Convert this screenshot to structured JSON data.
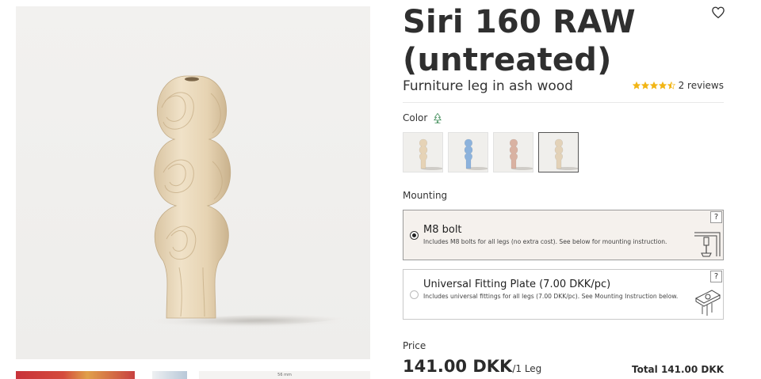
{
  "product": {
    "title_line1": "Siri 160 RAW",
    "title_line2": "(untreated)",
    "subtitle": "Furniture leg in ash wood",
    "rating": 4.5,
    "rating_max": 5,
    "reviews_label": "2 reviews",
    "star_color": "#f2b515"
  },
  "gallery": {
    "dimension_caption": "56 mm"
  },
  "color": {
    "label": "Color",
    "fsc_icon": "fsc-tree-icon",
    "swatches": [
      {
        "name": "raw-ash",
        "hex": "#e6d3b6",
        "selected": false
      },
      {
        "name": "blue",
        "hex": "#8cb2dc",
        "selected": false
      },
      {
        "name": "rose",
        "hex": "#d9b2a2",
        "selected": false
      },
      {
        "name": "raw-untreated",
        "hex": "#e3d2b8",
        "selected": true
      }
    ]
  },
  "mounting": {
    "label": "Mounting",
    "options": [
      {
        "title": "M8 bolt",
        "description": "Includes M8 bolts for all legs (no extra cost). See below for mounting instruction.",
        "help_label": "?",
        "selected": true
      },
      {
        "title": "Universal Fitting Plate (7.00 DKK/pc)",
        "description": "Includes universal fittings for all legs (7.00 DKK/pc). See Mounting Instruction below.",
        "help_label": "?",
        "selected": false
      }
    ]
  },
  "pricing": {
    "label": "Price",
    "amount": "141.00 DKK",
    "unit": "/1 Leg",
    "total": "Total 141.00 DKK"
  }
}
